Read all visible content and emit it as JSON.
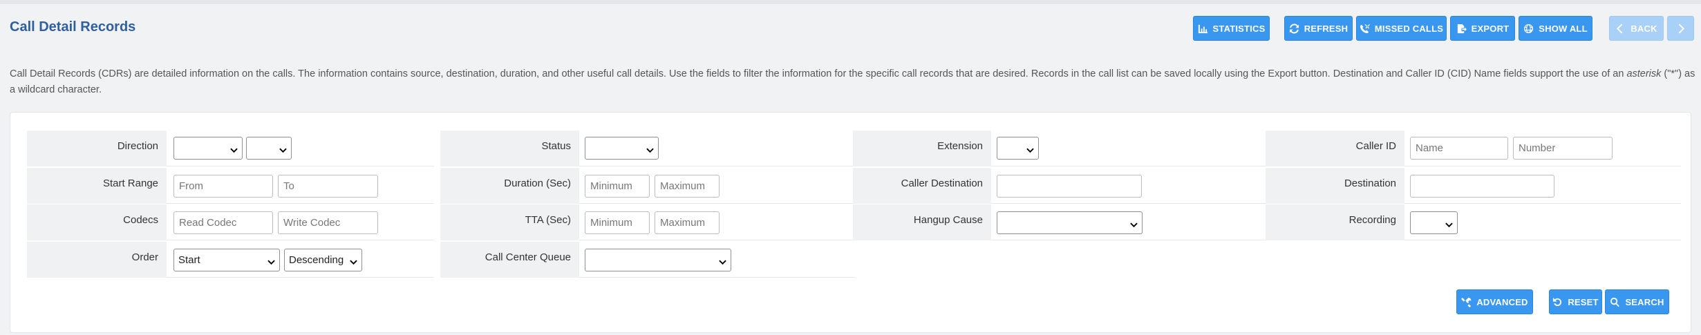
{
  "header": {
    "title": "Call Detail Records",
    "buttons": {
      "statistics": "STATISTICS",
      "refresh": "REFRESH",
      "missed_calls": "MISSED CALLS",
      "export": "EXPORT",
      "show_all": "SHOW ALL",
      "back": "BACK"
    }
  },
  "description": {
    "part1": "Call Detail Records (CDRs) are detailed information on the calls. The information contains source, destination, duration, and other useful call details. Use the fields to filter the information for the specific call records that are desired. Records in the call list can be saved locally using the Export button.   Destination and Caller ID (CID) Name fields support the use of an ",
    "italic": "asterisk",
    "part2": " (\"*\") as a wildcard character."
  },
  "filters": {
    "direction": {
      "label": "Direction"
    },
    "status": {
      "label": "Status"
    },
    "extension": {
      "label": "Extension"
    },
    "caller_id": {
      "label": "Caller ID",
      "name_placeholder": "Name",
      "number_placeholder": "Number"
    },
    "start_range": {
      "label": "Start Range",
      "from_placeholder": "From",
      "to_placeholder": "To"
    },
    "duration": {
      "label": "Duration (Sec)",
      "min_placeholder": "Minimum",
      "max_placeholder": "Maximum"
    },
    "caller_destination": {
      "label": "Caller Destination"
    },
    "destination": {
      "label": "Destination"
    },
    "codecs": {
      "label": "Codecs",
      "read_placeholder": "Read Codec",
      "write_placeholder": "Write Codec"
    },
    "tta": {
      "label": "TTA (Sec)",
      "min_placeholder": "Minimum",
      "max_placeholder": "Maximum"
    },
    "hangup_cause": {
      "label": "Hangup Cause"
    },
    "recording": {
      "label": "Recording"
    },
    "order": {
      "label": "Order",
      "field_value": "Start",
      "direction_value": "Descending"
    },
    "call_center_queue": {
      "label": "Call Center Queue"
    }
  },
  "footer_buttons": {
    "advanced": "ADVANCED",
    "reset": "RESET",
    "search": "SEARCH"
  },
  "colors": {
    "accent": "#3a97f0",
    "title": "#2e5f9e",
    "label_bg": "#f0f1f3"
  }
}
